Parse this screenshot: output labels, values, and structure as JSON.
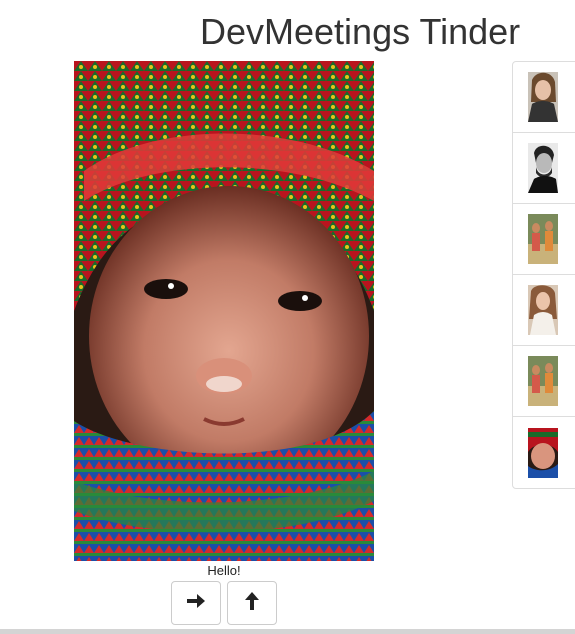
{
  "header": {
    "title": "DevMeetings Tinder"
  },
  "profile": {
    "photo_subject": "child-in-knitted-hat-photo",
    "caption": "Hello!"
  },
  "actions": [
    {
      "icon": "arrow-right-icon"
    },
    {
      "icon": "arrow-up-icon"
    }
  ],
  "thumbnails": [
    {
      "subject": "woman-portrait-thumbnail"
    },
    {
      "subject": "bearded-man-portrait-thumbnail"
    },
    {
      "subject": "group-of-women-thumbnail"
    },
    {
      "subject": "woman-in-white-thumbnail"
    },
    {
      "subject": "group-of-women-thumbnail"
    },
    {
      "subject": "child-in-knitted-hat-thumbnail"
    }
  ],
  "colors": {
    "accent": "#333333",
    "border": "#dddddd",
    "button_border": "#cccccc"
  }
}
